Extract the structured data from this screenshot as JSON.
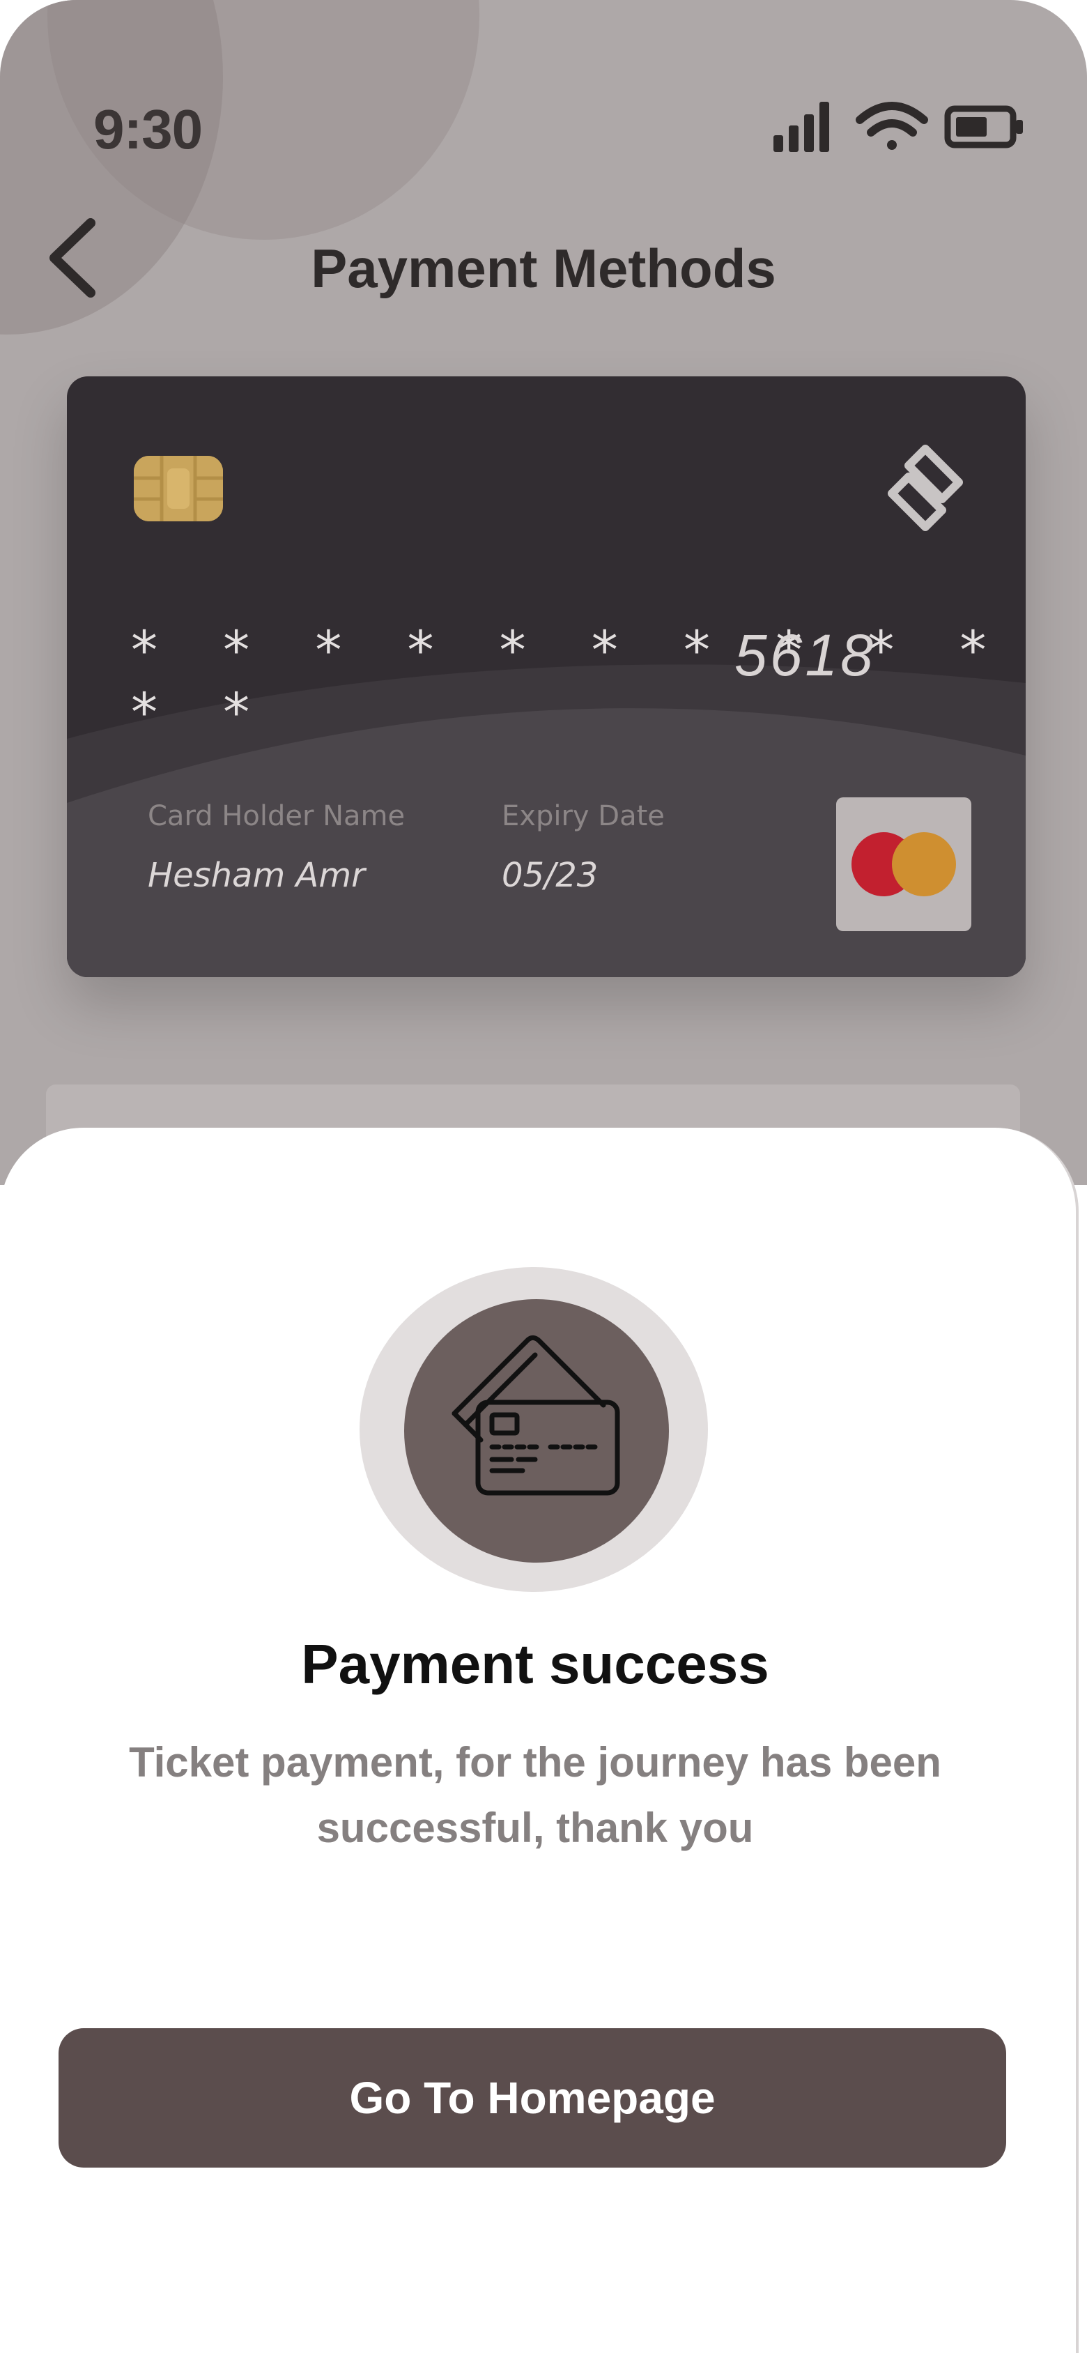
{
  "status_bar": {
    "time": "9:30"
  },
  "header": {
    "title": "Payment Methods"
  },
  "card": {
    "masked_number": "* * * *  * * * *  * * * *",
    "last_four": "5618",
    "holder_label": "Card Holder Name",
    "holder_name": "Hesham Amr",
    "expiry_label": "Expiry Date",
    "expiry_date": "05/23",
    "colors": {
      "card": "#322d32",
      "chip": "#c9a55c",
      "mc_red": "#c2202f",
      "mc_orange": "#cf8f30"
    }
  },
  "dialog": {
    "title": "Payment success",
    "message": "Ticket payment, for the journey has been successful, thank you",
    "button_label": "Go To Homepage",
    "icon": "credit-cards-icon",
    "accent_color": "#5b4d4d"
  }
}
